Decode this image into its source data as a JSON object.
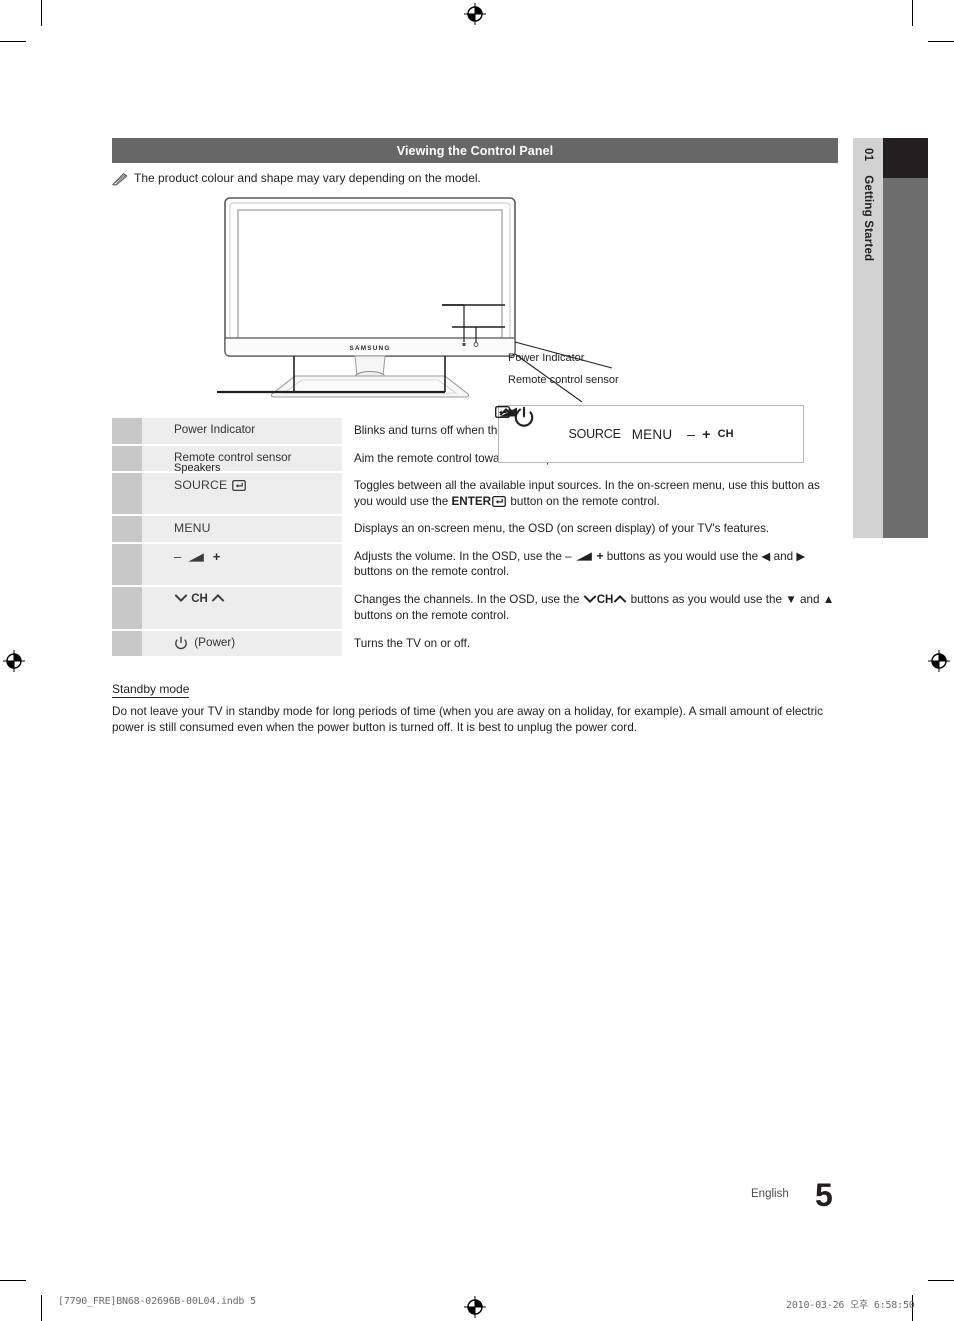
{
  "chapter_tab": {
    "number": "01",
    "title": "Getting Started"
  },
  "section": {
    "header": "Viewing the Control Panel",
    "note_icon": "pencil-note-icon",
    "note": "The product colour and shape may vary depending on the model."
  },
  "figure": {
    "brand": "SAMSUNG",
    "callouts": {
      "power_indicator": "Power Indicator",
      "remote_sensor": "Remote control sensor",
      "speakers": "Speakers"
    },
    "control_panel": {
      "source_label": "SOURCE",
      "source_icon": "enter-return-icon",
      "menu_label": "MENU",
      "volume_minus": "–",
      "volume_icon": "volume-wedge-icon",
      "volume_plus": "+",
      "ch_down_icon": "chevron-down-icon",
      "ch_label": "CH",
      "ch_up_icon": "chevron-up-icon",
      "power_icon": "power-icon"
    }
  },
  "spec_table": {
    "rows": [
      {
        "label": "Power Indicator",
        "label_style": "plain",
        "description": "Blinks and turns off when the power is on and lights up in standby mode."
      },
      {
        "label": "Remote control sensor",
        "label_style": "plain",
        "description": "Aim the remote control towards this spot on the TV."
      },
      {
        "label": "SOURCE",
        "label_icon": "enter-return-icon",
        "label_style": "strong",
        "description_part1": "Toggles between all the available input sources. In the on-screen menu, use this button as you would use the ",
        "description_bold": "ENTER",
        "description_icon": "enter-return-icon",
        "description_part2": " button on the remote control."
      },
      {
        "label": "MENU",
        "label_style": "strong",
        "description": "Displays an on-screen menu, the OSD (on screen display) of your TV's features."
      },
      {
        "label_minus": "–",
        "label_icon": "volume-wedge-icon",
        "label_plus": "+",
        "label_style": "strong",
        "description_part1": "Adjusts the volume. In the OSD, use the ",
        "description_inline_icons": "– volume-wedge-icon +",
        "description_part2": " buttons as you would use the ◀ and ▶ buttons on the remote control."
      },
      {
        "label_down": "chevron-down-icon",
        "label_ch": "CH",
        "label_up": "chevron-up-icon",
        "label_style": "strong",
        "description_part1": "Changes the channels. In the OSD, use the ",
        "description_inline_icons": "chevron-down-icon CH chevron-up-icon",
        "description_part2": " buttons as you would use the ▼ and ▲ buttons on the remote control."
      },
      {
        "label_icon": "power-icon",
        "label": "(Power)",
        "label_style": "plain",
        "description": "Turns the TV on or off."
      }
    ]
  },
  "standby": {
    "title": "Standby mode",
    "body": "Do not leave your TV in standby mode for long periods of time (when you are away on a holiday, for example). A small amount of electric power is still consumed even when the power button is turned off. It is best to unplug the power cord."
  },
  "page_footer": {
    "language": "English",
    "page_number": "5",
    "file_info": "[7790_FRE]BN68-02696B-00L04.indb   5",
    "timestamp": "2010-03-26   오후 6:58:50"
  },
  "colors": {
    "header_bar": "#676767",
    "tab_light": "#d2d2d2",
    "tab_dark": "#6d6d6d",
    "tab_black": "#231f20",
    "row_swatch": "#c8c8c8",
    "row_label_bg": "#ededed"
  }
}
